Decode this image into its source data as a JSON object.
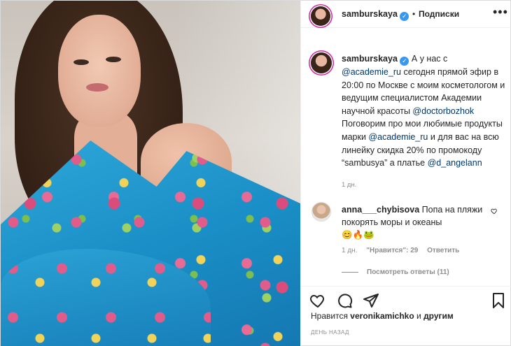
{
  "header": {
    "username": "samburskaya",
    "separator": "•",
    "follow_label": "Подписки",
    "more_label": "•••"
  },
  "caption": {
    "username": "samburskaya",
    "parts": [
      "А у нас с ",
      "@academie_ru",
      " сегодня прямой эфир в 20:00 по Москве с моим косметологом и ведущим специалистом Академии научной красоты ",
      "@doctorbozhok",
      " Поговорим про мои любимые продукты марки ",
      "@academie_ru",
      " и для вас на всю линейку скидка 20% по промокоду “sambusya” а платье ",
      "@d_angelann"
    ],
    "time": "1 дн."
  },
  "comment": {
    "username": "anna___chybisova",
    "text": "Попа на пляжи покорять моры и океаны",
    "emojis": "😊🔥🐸",
    "time": "1 дн.",
    "likes": "\"Нравится\": 29",
    "reply_label": "Ответить",
    "view_replies": "Посмотреть ответы (11)"
  },
  "footer": {
    "likes_prefix": "Нравится",
    "likes_user": "veronikamichko",
    "likes_and": "и",
    "likes_others": "другим",
    "date": "ДЕНЬ НАЗАД"
  },
  "colors": {
    "text": "#262626",
    "muted": "#8e8e8e",
    "link": "#00376b",
    "verified": "#3897f0",
    "border": "#dbdbdb"
  },
  "icons": [
    "heart-icon",
    "comment-icon",
    "share-icon",
    "bookmark-icon",
    "verified-icon"
  ]
}
